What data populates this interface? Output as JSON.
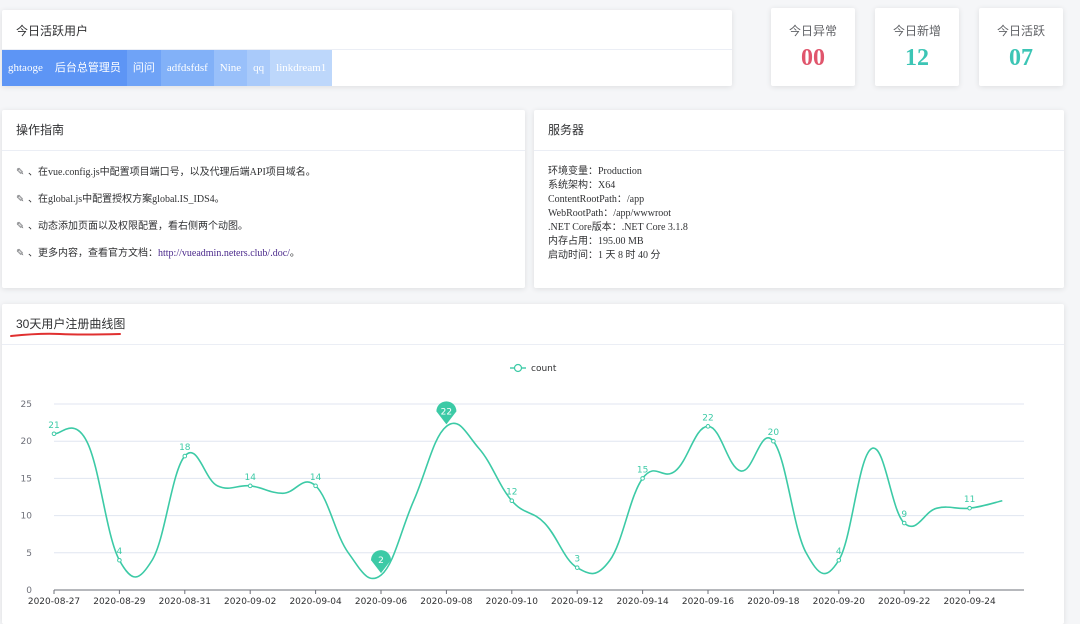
{
  "active_users": {
    "title": "今日活跃用户",
    "tags": [
      {
        "label": "ghtaoge",
        "color": "#5d95f5"
      },
      {
        "label": "后台总管理员",
        "color": "#5d95f5"
      },
      {
        "label": "问问",
        "color": "#6fa3f7"
      },
      {
        "label": "adfdsfdsf",
        "color": "#82b1f8"
      },
      {
        "label": "Nine",
        "color": "#99c0fa"
      },
      {
        "label": "qq",
        "color": "#a9cafa"
      },
      {
        "label": "linkdream1",
        "color": "#bdd7fb"
      }
    ]
  },
  "stats": {
    "abnormal": {
      "label": "今日异常",
      "value": "00",
      "color": "#e0556c"
    },
    "new": {
      "label": "今日新增",
      "value": "12",
      "color": "#3cc5b5"
    },
    "active": {
      "label": "今日活跃",
      "value": "07",
      "color": "#3cc5b5"
    }
  },
  "guide": {
    "title": "操作指南",
    "items": [
      "、在vue.config.js中配置项目端口号，以及代理后端API项目域名。",
      "、在global.js中配置授权方案global.IS_IDS4。",
      "、动态添加页面以及权限配置，看右侧两个动图。"
    ],
    "more_prefix": "、更多内容，查看官方文档：",
    "more_link": "http://vueadmin.neters.club/.doc/",
    "more_suffix": "。"
  },
  "server": {
    "title": "服务器",
    "rows": [
      "环境变量：Production",
      "系统架构：X64",
      "ContentRootPath：/app",
      "WebRootPath：/app/wwwroot",
      ".NET Core版本：.NET Core 3.1.8",
      "内存占用：195.00 MB",
      "启动时间：1 天 8 时 40 分"
    ]
  },
  "chart_title": "30天用户注册曲线图",
  "chart_data": {
    "type": "line",
    "series": [
      {
        "name": "count",
        "color": "#3ccaa6",
        "x": [
          "2020-08-27",
          "2020-08-28",
          "2020-08-29",
          "2020-08-30",
          "2020-08-31",
          "2020-09-01",
          "2020-09-02",
          "2020-09-03",
          "2020-09-04",
          "2020-09-05",
          "2020-09-06",
          "2020-09-07",
          "2020-09-08",
          "2020-09-09",
          "2020-09-10",
          "2020-09-11",
          "2020-09-12",
          "2020-09-13",
          "2020-09-14",
          "2020-09-15",
          "2020-09-16",
          "2020-09-17",
          "2020-09-18",
          "2020-09-19",
          "2020-09-20",
          "2020-09-21",
          "2020-09-22",
          "2020-09-23",
          "2020-09-24",
          "2020-09-25"
        ],
        "values": [
          21,
          20,
          4,
          4,
          18,
          14,
          14,
          13,
          14,
          5,
          2,
          12,
          22,
          19,
          12,
          9,
          3,
          4,
          15,
          16,
          22,
          16,
          20,
          5,
          4,
          19,
          9,
          11,
          11,
          12
        ]
      }
    ],
    "x_tick_labels": [
      "2020-08-27",
      "2020-08-29",
      "2020-08-31",
      "2020-09-02",
      "2020-09-04",
      "2020-09-06",
      "2020-09-08",
      "2020-09-10",
      "2020-09-12",
      "2020-09-14",
      "2020-09-16",
      "2020-09-18",
      "2020-09-20",
      "2020-09-22",
      "2020-09-24"
    ],
    "y_ticks": [
      0,
      5,
      10,
      15,
      20,
      25
    ],
    "ylim": [
      0,
      25
    ],
    "data_labels_at": [
      "2020-08-27",
      "2020-08-29",
      "2020-08-31",
      "2020-09-02",
      "2020-09-04",
      "2020-09-10",
      "2020-09-12",
      "2020-09-14",
      "2020-09-16",
      "2020-09-18",
      "2020-09-20",
      "2020-09-22",
      "2020-09-24"
    ],
    "max_marker": {
      "x": "2020-09-08",
      "value": 22
    },
    "min_marker": {
      "x": "2020-09-06",
      "value": 2
    },
    "legend_position": "top-center",
    "grid": true
  }
}
